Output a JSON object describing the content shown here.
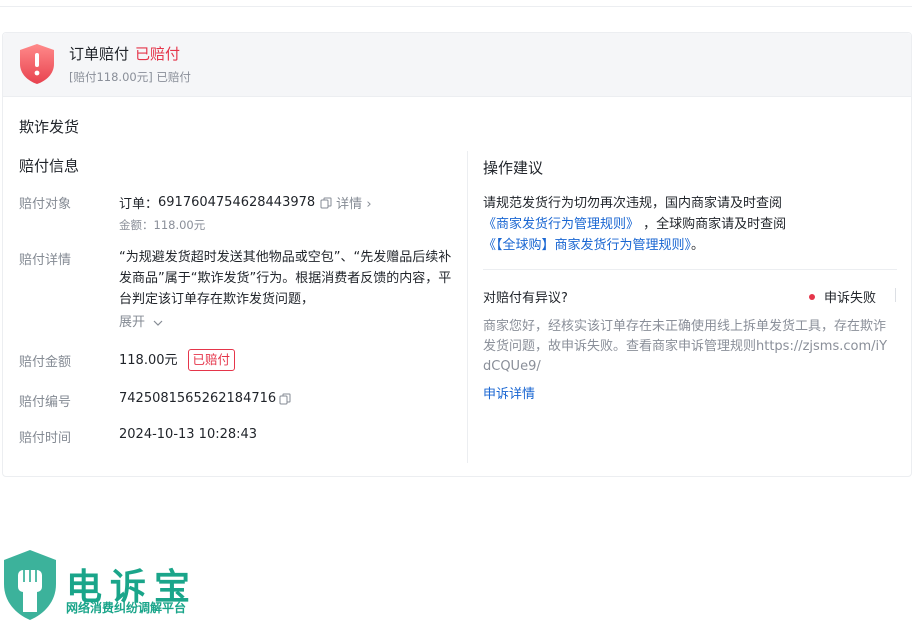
{
  "banner": {
    "title": "订单赔付",
    "status": "已赔付",
    "sub_amount": "[赔付118.00元]",
    "sub_status": "已赔付"
  },
  "case_type": "欺诈发货",
  "info": {
    "section_title": "赔付信息",
    "object_label": "赔付对象",
    "order_prefix": "订单：",
    "order_no": "6917604754628443978",
    "detail_link": "详情",
    "amount_line": "金额：118.00元",
    "detail_label": "赔付详情",
    "detail_text": "“为规避发货超时发送其他物品或空包”、“先发赠品后续补发商品”属于“欺诈发货”行为。根据消费者反馈的内容，平台判定该订单存在欺诈发货问题，",
    "expand": "展开",
    "pay_amount_label": "赔付金额",
    "pay_amount": "118.00元",
    "pay_badge": "已赔付",
    "pay_no_label": "赔付编号",
    "pay_no": "7425081565262184716",
    "pay_time_label": "赔付时间",
    "pay_time": "2024-10-13 10:28:43"
  },
  "advice": {
    "title": "操作建议",
    "line1": "请规范发货行为切勿再次违规，国内商家请及时查阅",
    "link1": "《商家发货行为管理规则》",
    "mid": "，全球购商家请及时查阅",
    "link2": "《【全球购】商家发货行为管理规则》",
    "end": "。"
  },
  "dispute": {
    "title": "对赔付有异议?",
    "status": "申诉失败",
    "desc": "商家您好，经核实该订单存在未正确使用线上拆单发货工具，存在欺诈发货问题，故申诉失败。查看商家申诉管理规则https://zjsms.com/iYdCQUe9/",
    "link": "申诉详情"
  },
  "watermark": {
    "name": "电诉宝",
    "tagline": "网络消费纠纷调解平台"
  },
  "colors": {
    "accent_red": "#e5354a",
    "link_blue": "#1966d2",
    "brand_green": "#1aa58a"
  }
}
